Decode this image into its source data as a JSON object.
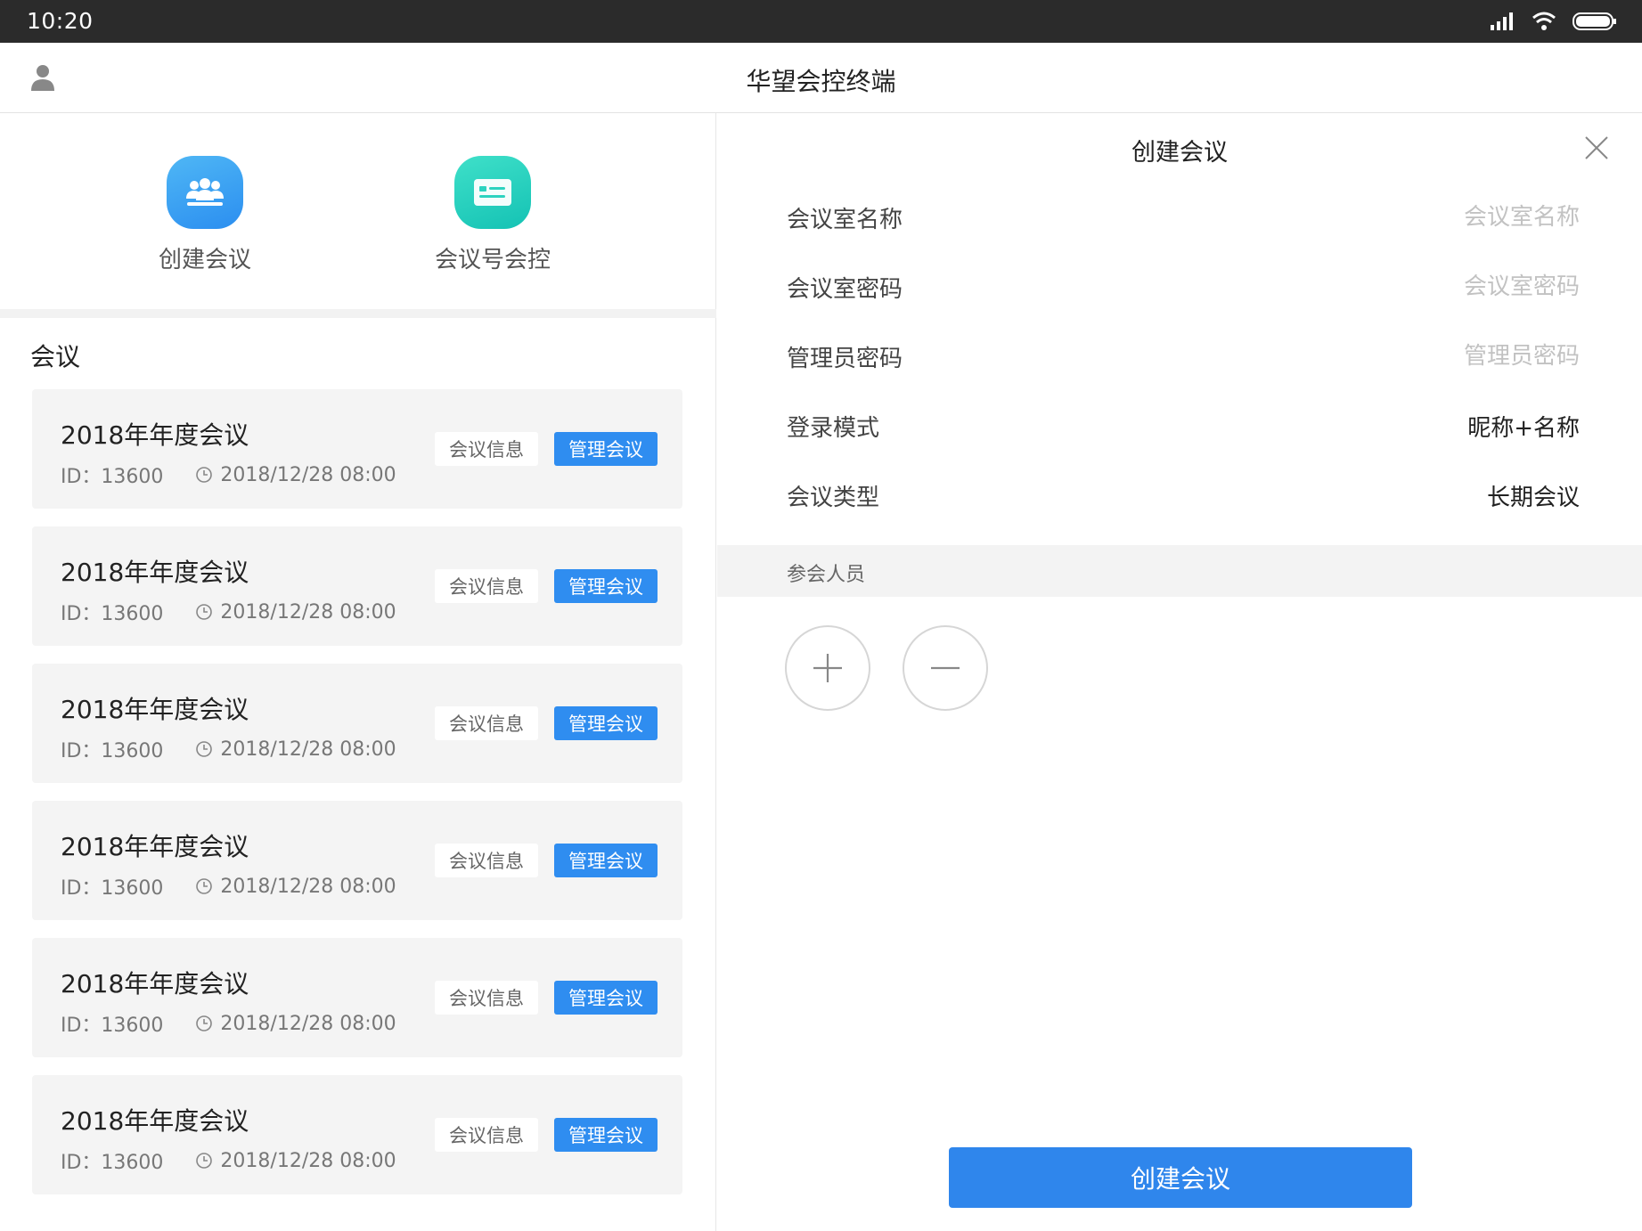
{
  "status_bar": {
    "time": "10:20"
  },
  "header": {
    "title": "华望会控终端"
  },
  "shortcuts": [
    {
      "label": "创建会议",
      "icon": "group-icon",
      "color": "#2b8ef0"
    },
    {
      "label": "会议号会控",
      "icon": "id-card-icon",
      "color": "#14c2b4"
    }
  ],
  "meetings": {
    "section_title": "会议",
    "info_label": "会议信息",
    "manage_label": "管理会议",
    "items": [
      {
        "title": "2018年年度会议",
        "id": "ID：13600",
        "time": "2018/12/28  08:00"
      },
      {
        "title": "2018年年度会议",
        "id": "ID：13600",
        "time": "2018/12/28  08:00"
      },
      {
        "title": "2018年年度会议",
        "id": "ID：13600",
        "time": "2018/12/28  08:00"
      },
      {
        "title": "2018年年度会议",
        "id": "ID：13600",
        "time": "2018/12/28  08:00"
      },
      {
        "title": "2018年年度会议",
        "id": "ID：13600",
        "time": "2018/12/28  08:00"
      },
      {
        "title": "2018年年度会议",
        "id": "ID：13600",
        "time": "2018/12/28  08:00"
      }
    ]
  },
  "create_panel": {
    "title": "创建会议",
    "fields": {
      "room_name": {
        "label": "会议室名称",
        "placeholder": "会议室名称",
        "value": ""
      },
      "room_password": {
        "label": "会议室密码",
        "placeholder": "会议室密码",
        "value": ""
      },
      "admin_password": {
        "label": "管理员密码",
        "placeholder": "管理员密码",
        "value": ""
      },
      "login_mode": {
        "label": "登录模式",
        "value": "昵称+名称"
      },
      "meeting_type": {
        "label": "会议类型",
        "value": "长期会议"
      }
    },
    "participants_label": "参会人员",
    "submit_label": "创建会议"
  },
  "colors": {
    "accent": "#2f86ec",
    "teal": "#14c2b4",
    "card_bg": "#f4f4f4"
  }
}
